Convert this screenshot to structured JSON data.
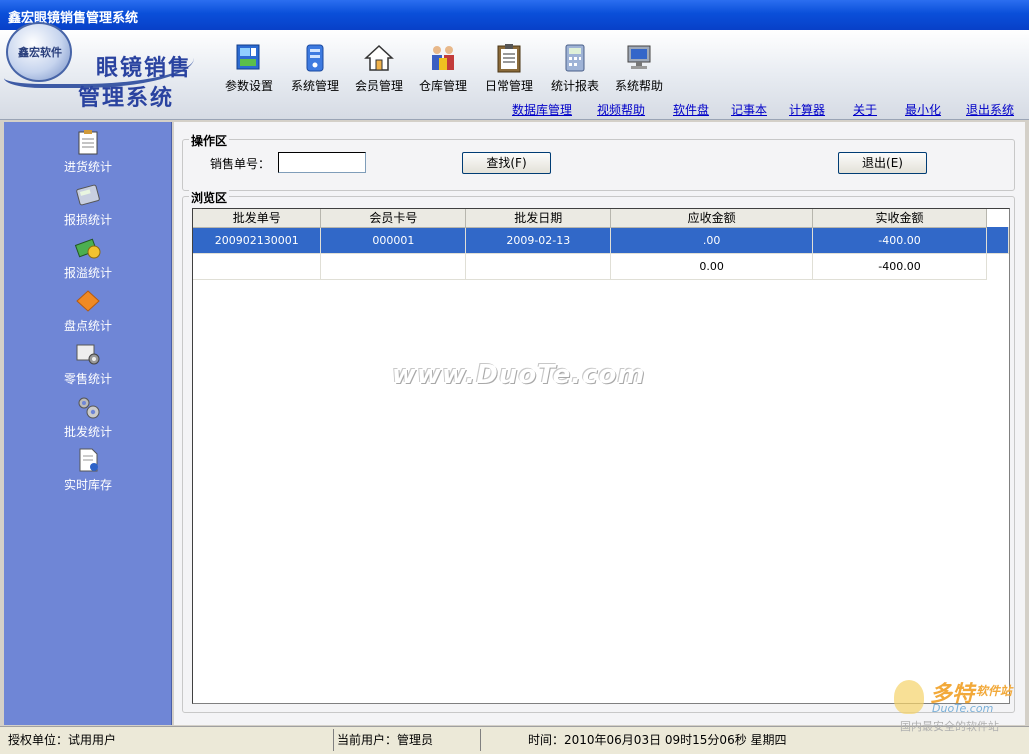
{
  "window": {
    "title": "鑫宏眼镜销售管理系统"
  },
  "brand": {
    "logo_text": "鑫宏软件",
    "line1": "眼镜销售",
    "line2": "管理系统"
  },
  "toolbar": {
    "buttons": [
      {
        "label": "参数设置",
        "icon": "settings-board-icon"
      },
      {
        "label": "系统管理",
        "icon": "system-icon"
      },
      {
        "label": "会员管理",
        "icon": "house-icon"
      },
      {
        "label": "仓库管理",
        "icon": "people-icon"
      },
      {
        "label": "日常管理",
        "icon": "clipboard-icon"
      },
      {
        "label": "统计报表",
        "icon": "calculator-icon"
      },
      {
        "label": "系统帮助",
        "icon": "computer-icon"
      }
    ],
    "links": [
      "数据库管理",
      "视频帮助",
      "软件盘",
      "记事本",
      "计算器",
      "关于",
      "最小化",
      "退出系统"
    ]
  },
  "sidebar": {
    "items": [
      {
        "label": "进货统计",
        "icon": "clipboard-icon"
      },
      {
        "label": "报损统计",
        "icon": "calculator-icon"
      },
      {
        "label": "报溢统计",
        "icon": "money-icon"
      },
      {
        "label": "盘点统计",
        "icon": "diamond-icon"
      },
      {
        "label": "零售统计",
        "icon": "gear-disk-icon"
      },
      {
        "label": "批发统计",
        "icon": "gears-icon"
      },
      {
        "label": "实时库存",
        "icon": "document-icon"
      }
    ]
  },
  "ops": {
    "legend": "操作区",
    "field_label": "销售单号：",
    "field_value": "",
    "search_button": "查找(F)",
    "exit_button": "退出(E)"
  },
  "browse": {
    "legend": "浏览区",
    "columns": [
      "批发单号",
      "会员卡号",
      "批发日期",
      "应收金额",
      "实收金额"
    ],
    "rows": [
      [
        "200902130001",
        "000001",
        "2009-02-13",
        ".00",
        "-400.00"
      ],
      [
        "",
        "",
        "",
        "0.00",
        "-400.00"
      ]
    ]
  },
  "watermark": "www.DuoTe.com",
  "status": {
    "unit": "授权单位：试用用户",
    "user": "当前用户：管理员",
    "time": "时间：2010年06月03日 09时15分06秒 星期四"
  },
  "corner": {
    "brand": "多特",
    "sub": "软件站",
    "site": "DuoTe.com",
    "tag": "国内最安全的软件站"
  },
  "colors": {
    "titlebar": "#0a4fd9",
    "sidebar": "#6f86d6",
    "selection": "#3168c8",
    "link": "#0000c8"
  }
}
